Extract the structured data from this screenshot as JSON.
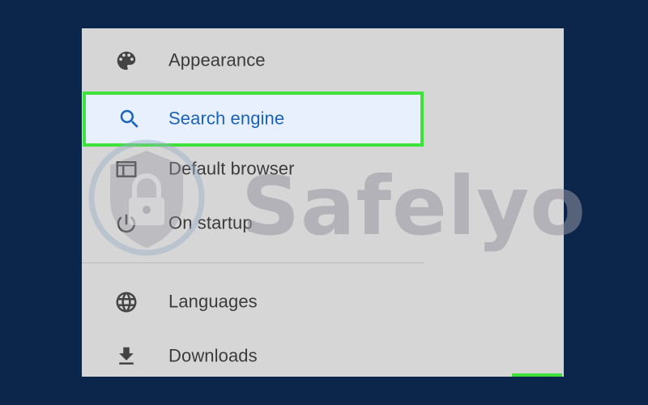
{
  "menu": {
    "items": [
      {
        "label": "Appearance",
        "icon": "palette-icon"
      },
      {
        "label": "Search engine",
        "icon": "search-icon",
        "selected": true
      },
      {
        "label": "Default browser",
        "icon": "browser-window-icon"
      },
      {
        "label": "On startup",
        "icon": "power-icon"
      },
      {
        "label": "Languages",
        "icon": "globe-icon"
      },
      {
        "label": "Downloads",
        "icon": "download-icon"
      }
    ]
  },
  "watermark": {
    "text": "Safelyo",
    "icon": "shield-lock-icon"
  },
  "colors": {
    "background": "#0b254b",
    "panel": "#d6d6d6",
    "highlight_fill": "#e8f0fe",
    "highlight_border": "#3ee23a",
    "selected_text": "#1a63b9",
    "text": "#3b3b3b",
    "icon": "#444444"
  }
}
